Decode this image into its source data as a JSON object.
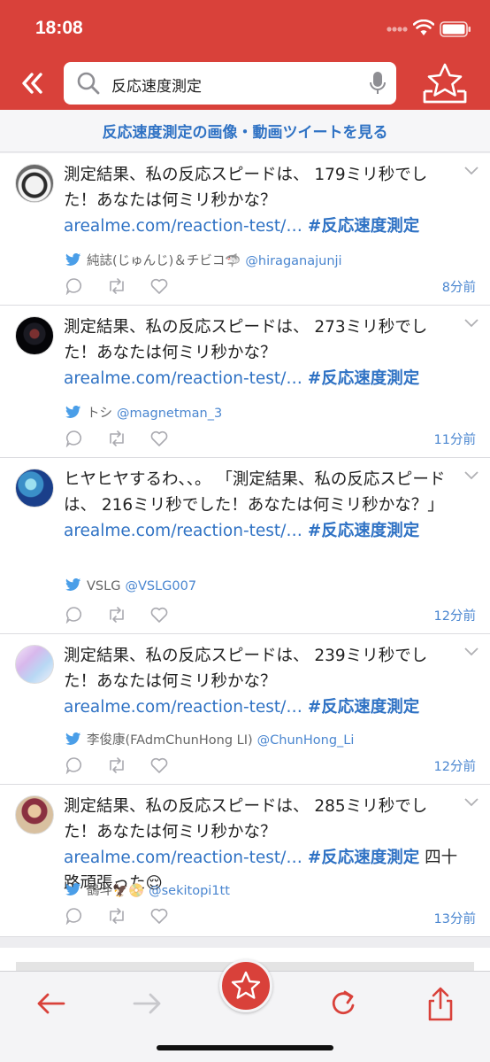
{
  "status": {
    "time": "18:08"
  },
  "search": {
    "query": "反応速度測定"
  },
  "banner": {
    "label": "反応速度測定の画像・動画ツイートを見る"
  },
  "tweets": [
    {
      "text": "測定結果、私の反応スピードは、 179ミリ秒でした！あなたは何ミリ秒かな？ ",
      "link": "arealme.com/reaction-test/…",
      "hashtag": "#反応速度測定",
      "extra": "",
      "name": "純誌(じゅんじ)＆チビコ🦈",
      "handle": "@hiraganajunji",
      "time": "8分前"
    },
    {
      "text": "測定結果、私の反応スピードは、 273ミリ秒でした！あなたは何ミリ秒かな？ ",
      "link": "arealme.com/reaction-test/…",
      "hashtag": "#反応速度測定",
      "extra": "",
      "name": "トシ",
      "handle": "@magnetman_3",
      "time": "11分前"
    },
    {
      "text": "ヒヤヒヤするわ、、。 「測定結果、私の反応スピードは、 216ミリ秒でした！あなたは何ミリ秒かな？」 ",
      "link": "arealme.com/reaction-test/…",
      "hashtag": "#反応速度測定",
      "extra": "",
      "name": "VSLG",
      "handle": "@VSLG007",
      "time": "12分前"
    },
    {
      "text": "測定結果、私の反応スピードは、 239ミリ秒でした！あなたは何ミリ秒かな？ ",
      "link": "arealme.com/reaction-test/…",
      "hashtag": "#反応速度測定",
      "extra": "",
      "name": "李俊康(FAdmChunHong LI)",
      "handle": "@ChunHong_Li",
      "time": "12分前"
    },
    {
      "text": "測定結果、私の反応スピードは、 285ミリ秒でした！あなたは何ミリ秒かな？ ",
      "link": "arealme.com/reaction-test/…",
      "hashtag": "#反応速度測定",
      "extra": " 四十路頑張った😌",
      "name": "鵲斗🦅📀",
      "handle": "@sekitopi1tt",
      "time": "13分前"
    }
  ],
  "colors": {
    "brand": "#d9413a",
    "link": "#2f72c4",
    "handle": "#4a86d0"
  }
}
